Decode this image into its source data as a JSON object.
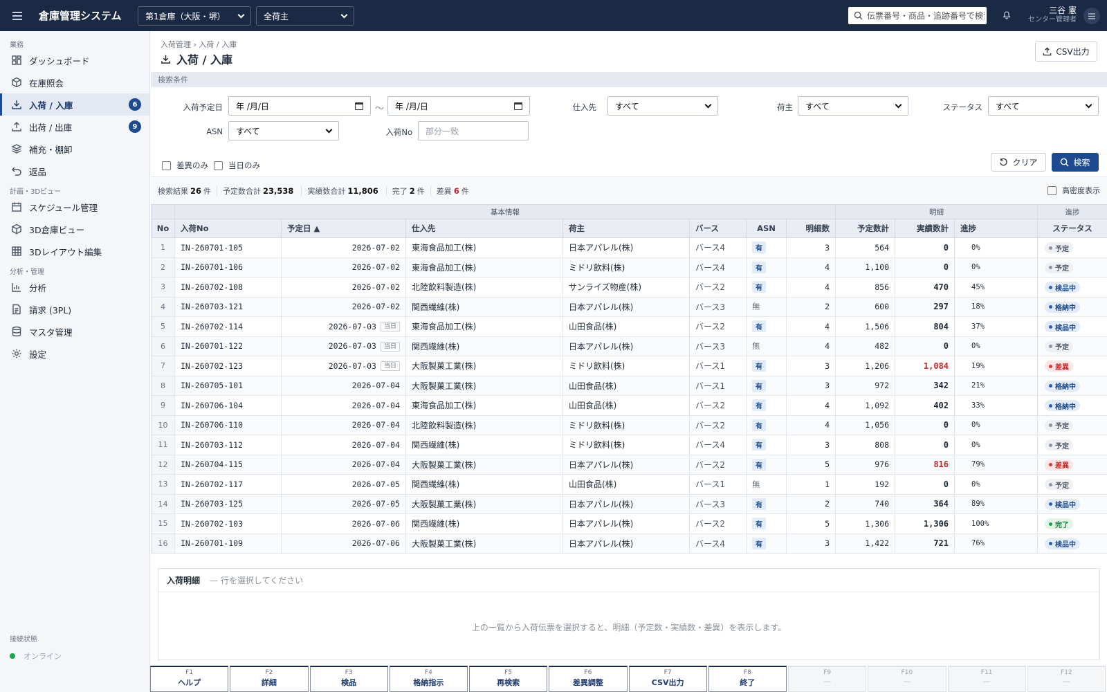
{
  "app": {
    "title": "倉庫管理システム"
  },
  "topbar": {
    "warehouse": "第1倉庫（大阪・堺）",
    "owner": "全荷主",
    "search_placeholder": "伝票番号・商品・追跡番号で検索",
    "user_name": "三谷 憲",
    "user_role": "センター管理者"
  },
  "sidebar": {
    "sections": [
      "業務",
      "計画・3Dビュー",
      "分析・管理"
    ],
    "items": [
      {
        "label": "ダッシュボード",
        "icon": "dashboard-icon"
      },
      {
        "label": "在庫照会",
        "icon": "box-icon"
      },
      {
        "label": "入荷 / 入庫",
        "icon": "download-icon",
        "badge": "6",
        "active": true
      },
      {
        "label": "出荷 / 出庫",
        "icon": "upload-icon",
        "badge": "9"
      },
      {
        "label": "補充・棚卸",
        "icon": "layers-icon"
      },
      {
        "label": "返品",
        "icon": "return-icon"
      },
      {
        "label": "スケジュール管理",
        "icon": "calendar-icon"
      },
      {
        "label": "3D倉庫ビュー",
        "icon": "cube-icon"
      },
      {
        "label": "3Dレイアウト編集",
        "icon": "grid-icon"
      },
      {
        "label": "分析",
        "icon": "chart-icon"
      },
      {
        "label": "請求 (3PL)",
        "icon": "invoice-icon"
      },
      {
        "label": "マスタ管理",
        "icon": "database-icon"
      },
      {
        "label": "設定",
        "icon": "gear-icon"
      }
    ],
    "conn_label": "接続状態",
    "conn_status": "オンライン"
  },
  "page": {
    "breadcrumb": "入荷管理 › 入荷 / 入庫",
    "title": "入荷 / 入庫",
    "csv_button": "CSV出力"
  },
  "filters": {
    "section_label": "検索条件",
    "date_label": "入荷予定日",
    "date_from": "年 /月/日",
    "date_to": "年 /月/日",
    "supplier_label": "仕入先",
    "supplier_value": "すべて",
    "owner_label": "荷主",
    "owner_value": "すべて",
    "status_label": "ステータス",
    "status_value": "すべて",
    "asn_label": "ASN",
    "asn_value": "すべて",
    "inbound_no_label": "入荷No",
    "inbound_no_placeholder": "部分一致",
    "diff_only": "差異のみ",
    "today_only": "当日のみ",
    "clear_button": "クリア",
    "search_button": "検索"
  },
  "summary": {
    "results_label": "検索結果",
    "results_value": "26",
    "results_unit": "件",
    "planned_label": "予定数合計",
    "planned_value": "23,538",
    "actual_label": "実績数合計",
    "actual_value": "11,806",
    "done_label": "完了",
    "done_value": "2",
    "done_unit": "件",
    "diff_label": "差異",
    "diff_value": "6",
    "diff_unit": "件",
    "dense_label": "高密度表示"
  },
  "table": {
    "groups": [
      "基本情報",
      "明細",
      "進捗"
    ],
    "headers": [
      "No",
      "入荷No",
      "予定日 ▲",
      "仕入先",
      "荷主",
      "バース",
      "ASN",
      "明細数",
      "予定数計",
      "実績数計",
      "進捗",
      "ステータス"
    ],
    "today_tag": "当日",
    "rows": [
      {
        "no": "1",
        "id": "IN-260701-105",
        "date": "2026-07-02",
        "today": false,
        "supplier": "東海食品加工(株)",
        "owner": "日本アパレル(株)",
        "berth": "バース4",
        "asn": "有",
        "lines": "3",
        "planned": "564",
        "actual": "0",
        "progress": "0%",
        "status": "予定",
        "st": "plan"
      },
      {
        "no": "2",
        "id": "IN-260701-106",
        "date": "2026-07-02",
        "today": false,
        "supplier": "東海食品加工(株)",
        "owner": "ミドリ飲料(株)",
        "berth": "バース4",
        "asn": "有",
        "lines": "4",
        "planned": "1,100",
        "actual": "0",
        "progress": "0%",
        "status": "予定",
        "st": "plan"
      },
      {
        "no": "3",
        "id": "IN-260702-108",
        "date": "2026-07-02",
        "today": false,
        "supplier": "北陸飲料製造(株)",
        "owner": "サンライズ物産(株)",
        "berth": "バース2",
        "asn": "有",
        "lines": "4",
        "planned": "856",
        "actual": "470",
        "progress": "45%",
        "status": "検品中",
        "st": "insp"
      },
      {
        "no": "4",
        "id": "IN-260703-121",
        "date": "2026-07-02",
        "today": false,
        "supplier": "関西繊維(株)",
        "owner": "日本アパレル(株)",
        "berth": "バース3",
        "asn": "無",
        "lines": "2",
        "planned": "600",
        "actual": "297",
        "progress": "18%",
        "status": "格納中",
        "st": "insp"
      },
      {
        "no": "5",
        "id": "IN-260702-114",
        "date": "2026-07-03",
        "today": true,
        "supplier": "東海食品加工(株)",
        "owner": "山田食品(株)",
        "berth": "バース2",
        "asn": "有",
        "lines": "4",
        "planned": "1,506",
        "actual": "804",
        "progress": "37%",
        "status": "検品中",
        "st": "insp"
      },
      {
        "no": "6",
        "id": "IN-260701-122",
        "date": "2026-07-03",
        "today": true,
        "supplier": "関西繊維(株)",
        "owner": "日本アパレル(株)",
        "berth": "バース3",
        "asn": "無",
        "lines": "4",
        "planned": "482",
        "actual": "0",
        "progress": "0%",
        "status": "予定",
        "st": "plan"
      },
      {
        "no": "7",
        "id": "IN-260702-123",
        "date": "2026-07-03",
        "today": true,
        "supplier": "大阪製菓工業(株)",
        "owner": "ミドリ飲料(株)",
        "berth": "バース1",
        "asn": "有",
        "lines": "3",
        "planned": "1,206",
        "actual": "1,084",
        "progress": "19%",
        "status": "差異",
        "st": "diff"
      },
      {
        "no": "8",
        "id": "IN-260705-101",
        "date": "2026-07-04",
        "today": false,
        "supplier": "大阪製菓工業(株)",
        "owner": "山田食品(株)",
        "berth": "バース1",
        "asn": "有",
        "lines": "3",
        "planned": "972",
        "actual": "342",
        "progress": "21%",
        "status": "格納中",
        "st": "insp"
      },
      {
        "no": "9",
        "id": "IN-260706-104",
        "date": "2026-07-04",
        "today": false,
        "supplier": "東海食品加工(株)",
        "owner": "山田食品(株)",
        "berth": "バース2",
        "asn": "有",
        "lines": "4",
        "planned": "1,092",
        "actual": "402",
        "progress": "33%",
        "status": "格納中",
        "st": "insp"
      },
      {
        "no": "10",
        "id": "IN-260706-110",
        "date": "2026-07-04",
        "today": false,
        "supplier": "北陸飲料製造(株)",
        "owner": "ミドリ飲料(株)",
        "berth": "バース2",
        "asn": "有",
        "lines": "4",
        "planned": "1,056",
        "actual": "0",
        "progress": "0%",
        "status": "予定",
        "st": "plan"
      },
      {
        "no": "11",
        "id": "IN-260703-112",
        "date": "2026-07-04",
        "today": false,
        "supplier": "関西繊維(株)",
        "owner": "ミドリ飲料(株)",
        "berth": "バース4",
        "asn": "有",
        "lines": "3",
        "planned": "808",
        "actual": "0",
        "progress": "0%",
        "status": "予定",
        "st": "plan"
      },
      {
        "no": "12",
        "id": "IN-260704-115",
        "date": "2026-07-04",
        "today": false,
        "supplier": "大阪製菓工業(株)",
        "owner": "日本アパレル(株)",
        "berth": "バース2",
        "asn": "有",
        "lines": "5",
        "planned": "976",
        "actual": "816",
        "progress": "79%",
        "status": "差異",
        "st": "diff"
      },
      {
        "no": "13",
        "id": "IN-260702-117",
        "date": "2026-07-05",
        "today": false,
        "supplier": "関西繊維(株)",
        "owner": "山田食品(株)",
        "berth": "バース1",
        "asn": "無",
        "lines": "1",
        "planned": "192",
        "actual": "0",
        "progress": "0%",
        "status": "予定",
        "st": "plan"
      },
      {
        "no": "14",
        "id": "IN-260703-125",
        "date": "2026-07-05",
        "today": false,
        "supplier": "大阪製菓工業(株)",
        "owner": "日本アパレル(株)",
        "berth": "バース3",
        "asn": "有",
        "lines": "2",
        "planned": "740",
        "actual": "364",
        "progress": "89%",
        "status": "検品中",
        "st": "insp"
      },
      {
        "no": "15",
        "id": "IN-260702-103",
        "date": "2026-07-06",
        "today": false,
        "supplier": "関西繊維(株)",
        "owner": "日本アパレル(株)",
        "berth": "バース2",
        "asn": "有",
        "lines": "5",
        "planned": "1,306",
        "actual": "1,306",
        "progress": "100%",
        "status": "完了",
        "st": "done"
      },
      {
        "no": "16",
        "id": "IN-260701-109",
        "date": "2026-07-06",
        "today": false,
        "supplier": "大阪製菓工業(株)",
        "owner": "日本アパレル(株)",
        "berth": "バース4",
        "asn": "有",
        "lines": "3",
        "planned": "1,422",
        "actual": "721",
        "progress": "76%",
        "status": "検品中",
        "st": "insp"
      }
    ]
  },
  "detail": {
    "title": "入荷明細",
    "hint": "— 行を選択してください",
    "message": "上の一覧から入荷伝票を選択すると、明細（予定数・実績数・差異）を表示します。"
  },
  "fkeys": [
    {
      "key": "F1",
      "label": "ヘルプ",
      "enabled": true
    },
    {
      "key": "F2",
      "label": "詳細",
      "enabled": true
    },
    {
      "key": "F3",
      "label": "検品",
      "enabled": true
    },
    {
      "key": "F4",
      "label": "格納指示",
      "enabled": true
    },
    {
      "key": "F5",
      "label": "再検索",
      "enabled": true
    },
    {
      "key": "F6",
      "label": "差異調整",
      "enabled": true
    },
    {
      "key": "F7",
      "label": "CSV出力",
      "enabled": true
    },
    {
      "key": "F8",
      "label": "終了",
      "enabled": true
    },
    {
      "key": "F9",
      "label": "—",
      "enabled": false
    },
    {
      "key": "F10",
      "label": "—",
      "enabled": false
    },
    {
      "key": "F11",
      "label": "—",
      "enabled": false
    },
    {
      "key": "F12",
      "label": "—",
      "enabled": false
    }
  ]
}
